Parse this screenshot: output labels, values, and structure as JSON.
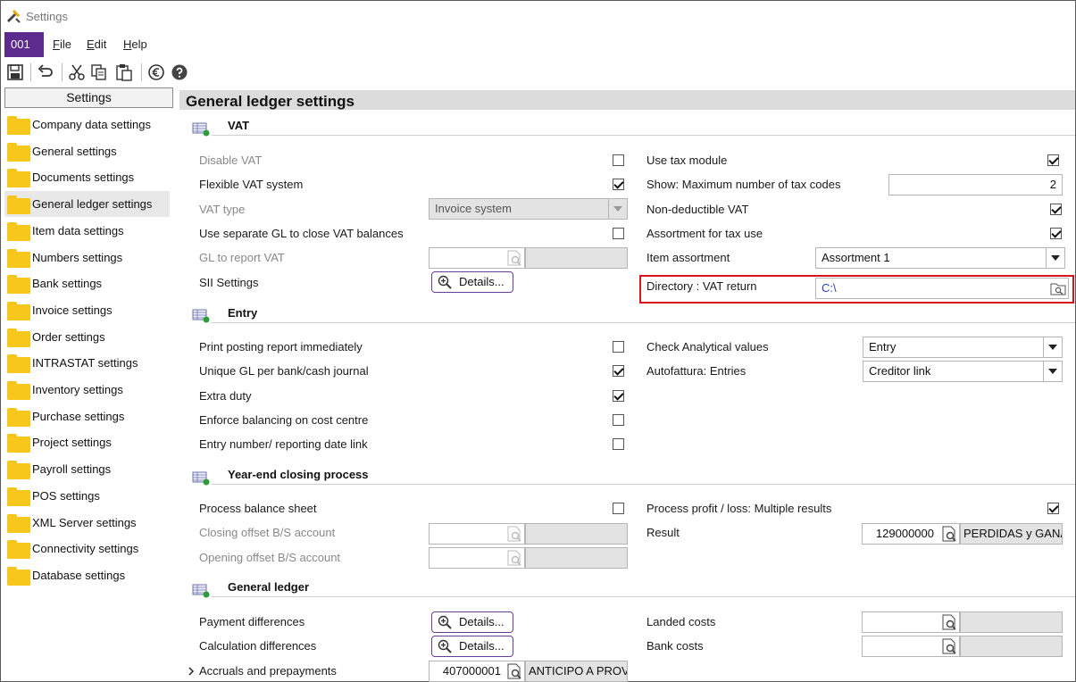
{
  "window": {
    "title": "Settings"
  },
  "company": "001",
  "menu": {
    "file": "File",
    "edit": "Edit",
    "help": "Help"
  },
  "toolbar": {
    "icons": [
      "save-icon",
      "undo-icon",
      "cut-icon",
      "copy-icon",
      "paste-icon",
      "euro-icon",
      "help-icon"
    ]
  },
  "sidebar": {
    "header": "Settings",
    "items": [
      {
        "label": "Company data settings"
      },
      {
        "label": "General settings"
      },
      {
        "label": "Documents settings"
      },
      {
        "label": "General ledger settings",
        "selected": true
      },
      {
        "label": "Item data settings"
      },
      {
        "label": "Numbers settings"
      },
      {
        "label": "Bank settings"
      },
      {
        "label": "Invoice settings"
      },
      {
        "label": "Order settings"
      },
      {
        "label": "INTRASTAT settings"
      },
      {
        "label": "Inventory settings"
      },
      {
        "label": "Purchase settings"
      },
      {
        "label": "Project settings"
      },
      {
        "label": "Payroll settings"
      },
      {
        "label": "POS settings"
      },
      {
        "label": "XML Server settings"
      },
      {
        "label": "Connectivity settings"
      },
      {
        "label": "Database settings"
      }
    ]
  },
  "main": {
    "title": "General ledger settings",
    "vat": {
      "title": "VAT",
      "disable_vat": "Disable VAT",
      "flexible_vat": "Flexible VAT system",
      "vat_type": "VAT type",
      "vat_type_value": "Invoice system",
      "separate_gl": "Use separate GL to close VAT balances",
      "gl_report": "GL to report VAT",
      "sii": "SII Settings",
      "details": "Details...",
      "use_tax_module": "Use tax module",
      "max_tax_codes": "Show: Maximum number of tax codes",
      "max_tax_codes_value": "2",
      "non_deductible": "Non-deductible VAT",
      "assortment_tax": "Assortment for tax use",
      "item_assortment": "Item assortment",
      "item_assortment_value": "Assortment 1",
      "directory_label": "Directory : VAT return",
      "directory_value": "C:\\"
    },
    "entry": {
      "title": "Entry",
      "print_posting": "Print posting report immediately",
      "unique_gl": "Unique GL per bank/cash journal",
      "extra_duty": "Extra duty",
      "enforce_balancing": "Enforce balancing on cost centre",
      "entry_number": "Entry number/ reporting date link",
      "check_analytical": "Check Analytical values",
      "check_analytical_value": "Entry",
      "autofattura": "Autofattura: Entries",
      "autofattura_value": "Creditor link"
    },
    "yearend": {
      "title": "Year-end closing process",
      "process_bs": "Process balance sheet",
      "closing_offset": "Closing offset B/S account",
      "opening_offset": "Opening offset B/S account",
      "process_pl": "Process profit / loss: Multiple results",
      "result": "Result",
      "result_code": "129000000",
      "result_desc": "PERDIDAS y GANANCIAS"
    },
    "gl": {
      "title": "General ledger",
      "payment_diff": "Payment differences",
      "calc_diff": "Calculation differences",
      "accruals": "Accruals and prepayments",
      "accruals_code": "407000001",
      "accruals_desc": "ANTICIPO A PROVEEDORES",
      "details": "Details...",
      "landed_costs": "Landed costs",
      "bank_costs": "Bank costs"
    }
  }
}
